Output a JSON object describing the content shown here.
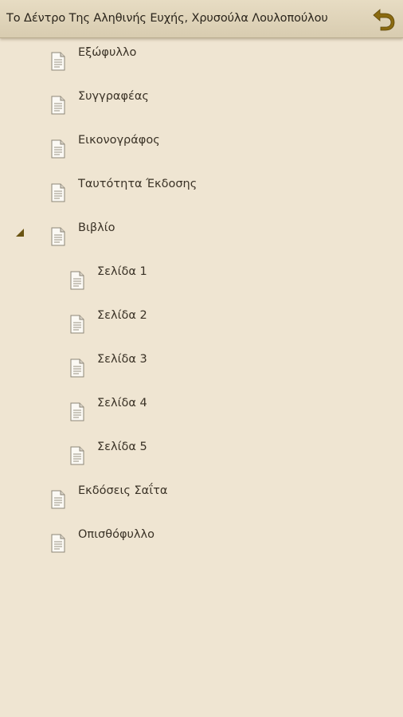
{
  "header": {
    "title": "Το Δέντρο Της Αληθινής Ευχής, Χρυσούλα Λουλοπούλου",
    "back_icon": "back-arrow-icon"
  },
  "toc": {
    "items": [
      {
        "label": "Εξώφυλλο"
      },
      {
        "label": "Συγγραφέας"
      },
      {
        "label": "Εικονογράφος"
      },
      {
        "label": "Ταυτότητα Έκδοσης"
      },
      {
        "label": "Βιβλίο",
        "expanded": true
      },
      {
        "label": "Σελίδα 1"
      },
      {
        "label": "Σελίδα 2"
      },
      {
        "label": "Σελίδα 3"
      },
      {
        "label": "Σελίδα 4"
      },
      {
        "label": "Σελίδα 5"
      },
      {
        "label": "Εκδόσεις Σαΐτα"
      },
      {
        "label": "Οπισθόφυλλο"
      }
    ]
  },
  "colors": {
    "background": "#efe5d2",
    "titlebar": "#ddd1b6",
    "accent": "#8a6a10"
  }
}
